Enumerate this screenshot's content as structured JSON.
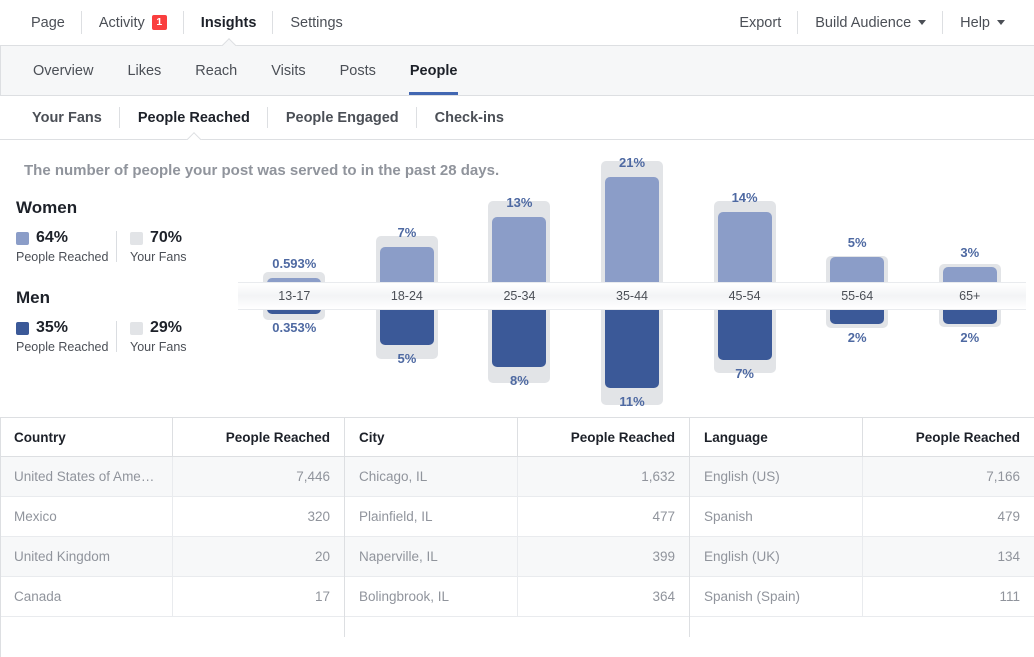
{
  "topnav": {
    "left_items": [
      {
        "label": "Page",
        "active": false,
        "badge": null
      },
      {
        "label": "Activity",
        "active": false,
        "badge": "1"
      },
      {
        "label": "Insights",
        "active": true,
        "badge": null
      },
      {
        "label": "Settings",
        "active": false,
        "badge": null
      }
    ],
    "right_items": [
      {
        "label": "Export",
        "caret": false
      },
      {
        "label": "Build Audience",
        "caret": true
      },
      {
        "label": "Help",
        "caret": true
      }
    ]
  },
  "subnav": {
    "items": [
      {
        "label": "Overview",
        "active": false
      },
      {
        "label": "Likes",
        "active": false
      },
      {
        "label": "Reach",
        "active": false
      },
      {
        "label": "Visits",
        "active": false
      },
      {
        "label": "Posts",
        "active": false
      },
      {
        "label": "People",
        "active": true
      }
    ]
  },
  "tertnav": {
    "items": [
      {
        "label": "Your Fans",
        "active": false
      },
      {
        "label": "People Reached",
        "active": true
      },
      {
        "label": "People Engaged",
        "active": false
      },
      {
        "label": "Check-ins",
        "active": false
      }
    ]
  },
  "chart_section": {
    "description": "The number of people your post was served to in the past 28 days.",
    "legend": [
      {
        "title": "Women",
        "reached_pct": "64%",
        "reached_label": "People Reached",
        "reached_color": "#8b9dc8",
        "fans_pct": "70%",
        "fans_label": "Your Fans",
        "fans_color": "#e2e4e7"
      },
      {
        "title": "Men",
        "reached_pct": "35%",
        "reached_label": "People Reached",
        "reached_color": "#3b5998",
        "fans_pct": "29%",
        "fans_label": "Your Fans",
        "fans_color": "#e2e4e7"
      }
    ]
  },
  "chart_data": {
    "type": "bar",
    "title": "The number of people your post was served to in the past 28 days.",
    "xlabel": "",
    "ylabel": "",
    "orientation": "diverging-vertical",
    "grid": false,
    "legend_position": "left",
    "categories": [
      "13-17",
      "18-24",
      "25-34",
      "35-44",
      "45-54",
      "55-64",
      "65+"
    ],
    "series": [
      {
        "name": "Women - People Reached",
        "color": "#8b9dc8",
        "direction": "up",
        "values": [
          0.593,
          7,
          13,
          21,
          14,
          5,
          3
        ],
        "labels": [
          "0.593%",
          "7%",
          "13%",
          "21%",
          "14%",
          "5%",
          "3%"
        ]
      },
      {
        "name": "Men - People Reached",
        "color": "#3b5998",
        "direction": "down",
        "values": [
          0.353,
          5,
          8,
          11,
          7,
          2,
          2
        ],
        "labels": [
          "0.353%",
          "5%",
          "8%",
          "11%",
          "7%",
          "2%",
          "2%"
        ]
      },
      {
        "name": "Women - Your Fans",
        "color": "#e2e4e7",
        "direction": "up",
        "values": [
          0.8,
          8,
          15,
          23,
          15,
          4,
          2.4
        ],
        "labels": []
      },
      {
        "name": "Men - Your Fans",
        "color": "#e2e4e7",
        "direction": "down",
        "values": [
          0.5,
          6,
          9.5,
          12.5,
          8,
          1.7,
          1.6
        ],
        "labels": []
      }
    ],
    "totals": {
      "women_reached": "64%",
      "men_reached": "35%",
      "women_fans": "70%",
      "men_fans": "29%"
    }
  },
  "tables": [
    {
      "name": "country",
      "col_label": "Country",
      "col_value": "People Reached",
      "rows": [
        {
          "label": "United States of America",
          "value": "7,446"
        },
        {
          "label": "Mexico",
          "value": "320"
        },
        {
          "label": "United Kingdom",
          "value": "20"
        },
        {
          "label": "Canada",
          "value": "17"
        }
      ]
    },
    {
      "name": "city",
      "col_label": "City",
      "col_value": "People Reached",
      "rows": [
        {
          "label": "Chicago, IL",
          "value": "1,632"
        },
        {
          "label": "Plainfield, IL",
          "value": "477"
        },
        {
          "label": "Naperville, IL",
          "value": "399"
        },
        {
          "label": "Bolingbrook, IL",
          "value": "364"
        }
      ]
    },
    {
      "name": "language",
      "col_label": "Language",
      "col_value": "People Reached",
      "rows": [
        {
          "label": "English (US)",
          "value": "7,166"
        },
        {
          "label": "Spanish",
          "value": "479"
        },
        {
          "label": "English (UK)",
          "value": "134"
        },
        {
          "label": "Spanish (Spain)",
          "value": "111"
        }
      ]
    }
  ]
}
